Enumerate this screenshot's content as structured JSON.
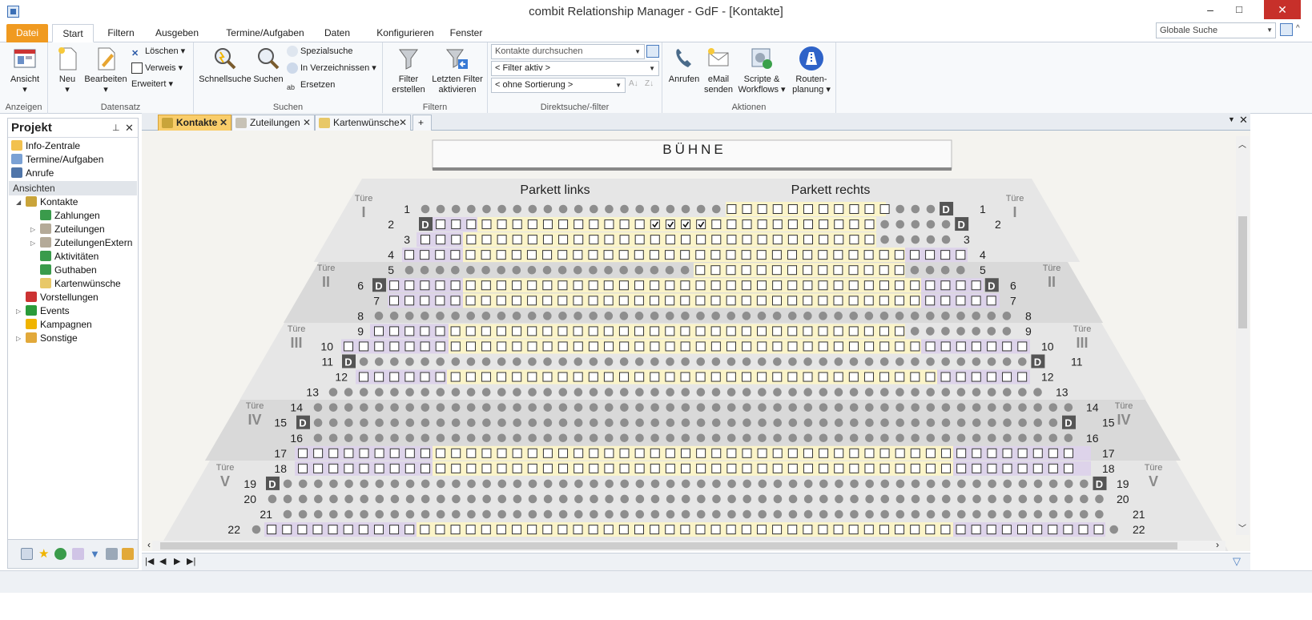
{
  "window": {
    "title": "combit Relationship Manager - GdF - [Kontakte]",
    "minimize": "–",
    "maximize": "□",
    "close": "✕"
  },
  "menu": {
    "tabs": [
      "Datei",
      "Start",
      "Filtern",
      "Ausgeben",
      "Termine/Aufgaben",
      "Daten",
      "Konfigurieren",
      "Fenster"
    ],
    "active": "Start",
    "global_search_placeholder": "Globale Suche"
  },
  "ribbon": {
    "groups": {
      "anzeigen": "Anzeigen",
      "datensatz": "Datensatz",
      "suchen": "Suchen",
      "filtern": "Filtern",
      "direkt": "Direktsuche/-filter",
      "aktionen": "Aktionen"
    },
    "buttons": {
      "ansicht": "Ansicht",
      "neu": "Neu",
      "bearbeiten": "Bearbeiten",
      "loeschen": "Löschen",
      "verweis": "Verweis",
      "erweitert": "Erweitert",
      "schnellsuche": "Schnellsuche",
      "suchen": "Suchen",
      "spezialsuche": "Spezialsuche",
      "in_verzeichnissen": "In Verzeichnissen",
      "ersetzen": "Ersetzen",
      "filter_erstellen_1": "Filter",
      "filter_erstellen_2": "erstellen",
      "letzten_filter_1": "Letzten Filter",
      "letzten_filter_2": "aktivieren",
      "anrufen": "Anrufen",
      "email_1": "eMail",
      "email_2": "senden",
      "scripte_1": "Scripte &",
      "scripte_2": "Workflows",
      "routen_1": "Routen-",
      "routen_2": "planung"
    },
    "direkt": {
      "search_placeholder": "Kontakte durchsuchen",
      "filter": "< Filter aktiv >",
      "sort": "< ohne Sortierung >"
    }
  },
  "project_panel": {
    "title": "Projekt",
    "top_items": [
      "Info-Zentrale",
      "Termine/Aufgaben",
      "Anrufe"
    ],
    "section": "Ansichten",
    "tree": [
      {
        "label": "Kontakte",
        "level": 1,
        "expander": "◢"
      },
      {
        "label": "Zahlungen",
        "level": 2,
        "expander": ""
      },
      {
        "label": "Zuteilungen",
        "level": 2,
        "expander": "▷"
      },
      {
        "label": "ZuteilungenExtern",
        "level": 2,
        "expander": "▷"
      },
      {
        "label": "Aktivitäten",
        "level": 2,
        "expander": ""
      },
      {
        "label": "Guthaben",
        "level": 2,
        "expander": ""
      },
      {
        "label": "Kartenwünsche",
        "level": 2,
        "expander": ""
      },
      {
        "label": "Vorstellungen",
        "level": 1,
        "expander": ""
      },
      {
        "label": "Events",
        "level": 1,
        "expander": "▷"
      },
      {
        "label": "Kampagnen",
        "level": 1,
        "expander": ""
      },
      {
        "label": "Sonstige",
        "level": 1,
        "expander": "▷"
      }
    ]
  },
  "doc_tabs": [
    {
      "label": "Kontakte",
      "active": true
    },
    {
      "label": "Zuteilungen",
      "active": false
    },
    {
      "label": "Kartenwünsche",
      "active": false
    }
  ],
  "seating": {
    "stage": "BÜHNE",
    "section_left": "Parkett links",
    "section_right": "Parkett rechts",
    "door_label": "Türe",
    "doors": [
      "I",
      "II",
      "III",
      "IV",
      "V"
    ],
    "row_labels": [
      "1",
      "2",
      "3",
      "4",
      "5",
      "6",
      "7",
      "8",
      "9",
      "10",
      "11",
      "12",
      "13",
      "14",
      "15",
      "16",
      "17",
      "18",
      "19",
      "20",
      "21",
      "22"
    ],
    "wheelchair_mark": "D",
    "checked_seats_row": "2",
    "checked_seats_count": 4
  },
  "colors": {
    "accent_orange": "#f09a20",
    "tab_active": "#f9cd6a",
    "seat_dot": "#8e8e8e",
    "zone_purple": "#ddd3ea",
    "zone_yellow": "#fbf4c8",
    "door_roman": "#8a8a8a",
    "wheelchair_bg": "#555555"
  }
}
